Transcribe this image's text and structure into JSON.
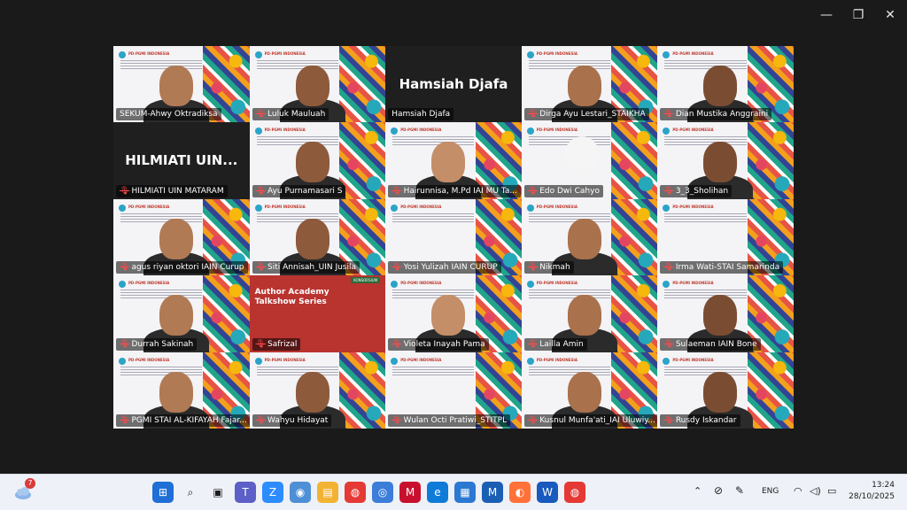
{
  "window": {
    "controls": {
      "minimize_icon": "—",
      "maximize_icon": "❐",
      "close_icon": "✕"
    }
  },
  "participants": [
    {
      "name": "SEKUM-Ahwy Oktradiksa",
      "muted": false,
      "active": true,
      "video": "person"
    },
    {
      "name": "Luluk Mauluah",
      "muted": true,
      "video": "person"
    },
    {
      "name": "Hamsiah Djafa",
      "muted": false,
      "video": "none",
      "display_name": "Hamsiah Djafa"
    },
    {
      "name": "Dirga Ayu Lestari_STAIKHA",
      "muted": true,
      "video": "person"
    },
    {
      "name": "Dian Mustika Anggraini",
      "muted": true,
      "video": "person"
    },
    {
      "name": "HILMIATI UIN MATARAM",
      "muted": true,
      "video": "none",
      "display_name": "HILMIATI UIN..."
    },
    {
      "name": "Ayu Purnamasari S",
      "muted": true,
      "video": "person"
    },
    {
      "name": "Hairunnisa, M.Pd   IAI MU Ta...",
      "muted": true,
      "video": "person"
    },
    {
      "name": "Edo Dwi Cahyo",
      "muted": true,
      "video": "avatar"
    },
    {
      "name": "3_3_Sholihan",
      "muted": true,
      "video": "person"
    },
    {
      "name": "agus riyan oktori IAIN Curup",
      "muted": true,
      "video": "person"
    },
    {
      "name": "Siti Annisah_UIN Jusila",
      "muted": true,
      "video": "person"
    },
    {
      "name": "Yosi Yulizah IAIN CURUP",
      "muted": true,
      "video": "slide"
    },
    {
      "name": "Nikmah",
      "muted": true,
      "video": "person"
    },
    {
      "name": "Irma Wati-STAI Samarinda",
      "muted": true,
      "video": "slide"
    },
    {
      "name": "Durrah Sakinah",
      "muted": true,
      "video": "person"
    },
    {
      "name": "Safrizal",
      "muted": true,
      "video": "poster",
      "poster_title": "Author Academy Talkshow Series",
      "poster_tag": "KONSORSIUM"
    },
    {
      "name": "Violeta Inayah Pama",
      "muted": true,
      "video": "person"
    },
    {
      "name": "Lailla Amin",
      "muted": true,
      "video": "person"
    },
    {
      "name": "Sulaeman IAIN Bone",
      "muted": true,
      "video": "person"
    },
    {
      "name": "PGMI STAI AL-KIFAYAH Fajar...",
      "muted": true,
      "video": "person"
    },
    {
      "name": "Wahyu Hidayat",
      "muted": true,
      "video": "person"
    },
    {
      "name": "Wulan Octi Pratiwi_STITPL",
      "muted": true,
      "video": "slide"
    },
    {
      "name": "Kusnul Munfa'ati_IAI Uluwiy...",
      "muted": true,
      "video": "person"
    },
    {
      "name": "Rusdy Iskandar",
      "muted": true,
      "video": "person"
    }
  ],
  "slide": {
    "brand": "PD-PGMI INDONESIA"
  },
  "taskbar": {
    "weather_badge": "7",
    "apps": [
      "windows-start",
      "search",
      "task-view",
      "teams",
      "zoom",
      "browser-app",
      "file-explorer",
      "chrome",
      "globe-app",
      "mcafee",
      "edge",
      "store",
      "mail-app",
      "firefox",
      "word",
      "chrome-profile"
    ],
    "tray": {
      "language": "ENG",
      "time": "13:24",
      "date": "28/10/2025"
    }
  },
  "colors": {
    "active_border": "#23d959",
    "muted_mic": "#ff4a4a",
    "stage_bg": "#1a1a1a"
  }
}
